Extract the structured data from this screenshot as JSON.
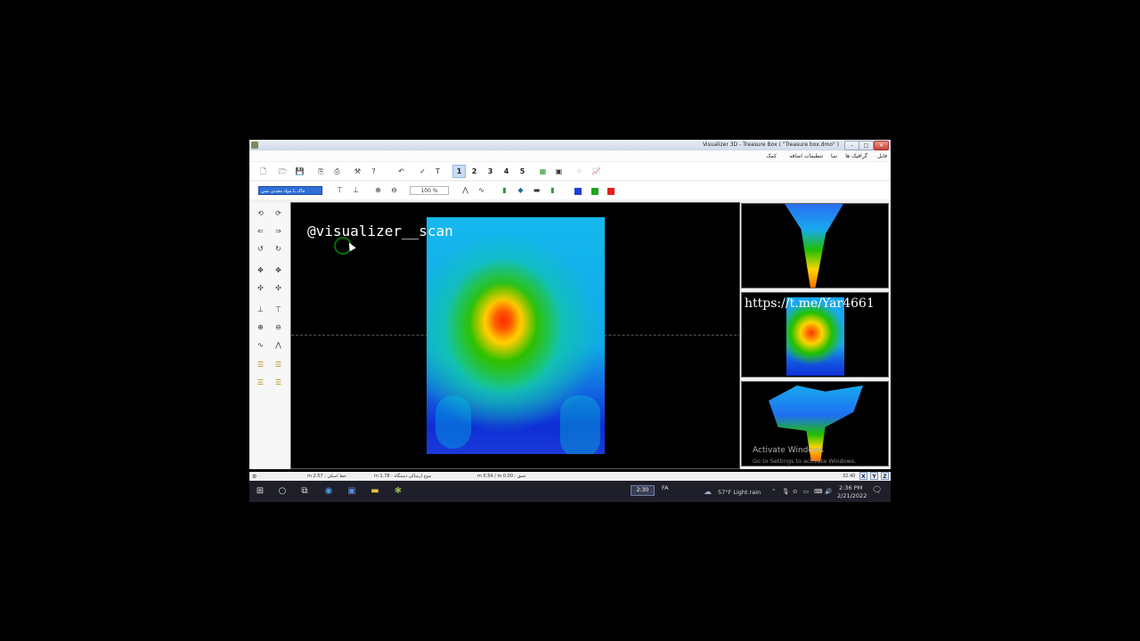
{
  "window": {
    "title": "Visualizer 3D - Treasure Box ( \"Treasure box.dmo\" )",
    "controls": {
      "minimize": "–",
      "maximize": "□",
      "close": "✕"
    }
  },
  "menu": [
    "فایل",
    "گرافیک ها",
    "نما",
    "تنظیمات اضافه",
    "کمک"
  ],
  "toolbar1": {
    "icons": [
      "new-file-icon",
      "open-folder-icon",
      "save-icon",
      "export-icon",
      "print-icon",
      "tools-icon",
      "help-icon",
      "undo-icon",
      "scan-icon",
      "text-icon",
      "grid-icon",
      "window-icon",
      "scatter-icon",
      "chart-icon"
    ],
    "view_numbers": [
      "1",
      "2",
      "3",
      "4",
      "5"
    ],
    "active_view": "1"
  },
  "toolbar2": {
    "mode_select": "خاک با مواد معدنی مس",
    "zoom_value": "100 %",
    "colors": {
      "blue": "#1f3fd8",
      "green": "#1fa51f",
      "red": "#e32020"
    }
  },
  "canvas": {
    "watermark": "@visualizer__scan"
  },
  "previews": {
    "url": "https://t.me/Yar4661",
    "activate_title": "Activate Windows",
    "activate_sub": "Go to Settings to activate Windows."
  },
  "status": {
    "ground": "m 2.57 : خط اسکن",
    "device": "m 1.78 : موج ارسالی دستگاه",
    "depth": "m 0.54 / m 0.00 : عمق",
    "coord": "32.40",
    "axes": [
      "X",
      "Y",
      "Z"
    ]
  },
  "taskbar": {
    "clock_box": "2:30",
    "lang": "FA",
    "weather": "57°F  Light rain",
    "time": "2:36 PM",
    "date": "2/21/2022"
  }
}
